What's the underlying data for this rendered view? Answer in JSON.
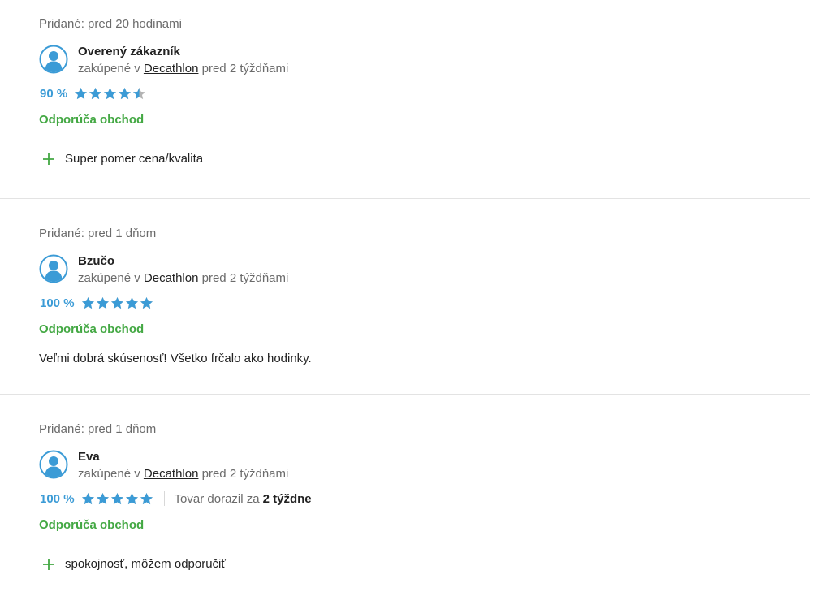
{
  "colors": {
    "accent_blue": "#3b9bd6",
    "recommend_green": "#43a843",
    "star_empty": "#b3b3b3"
  },
  "icons": {
    "avatar": "user-avatar-icon",
    "star": "star-icon",
    "pro": "plus-icon"
  },
  "reviews": [
    {
      "added": "Pridané: pred 20 hodinami",
      "author": "Overený zákazník",
      "purchase_prefix": "zakúpené v",
      "shop": "Decathlon",
      "purchase_suffix": "pred 2 týždňami",
      "percent": "90 %",
      "rating_fraction": 0.9,
      "recommends": "Odporúča obchod",
      "pro": "Super pomer cena/kvalita"
    },
    {
      "added": "Pridané: pred 1 dňom",
      "author": "Bzučo",
      "purchase_prefix": "zakúpené v",
      "shop": "Decathlon",
      "purchase_suffix": "pred 2 týždňami",
      "percent": "100 %",
      "rating_fraction": 1.0,
      "recommends": "Odporúča obchod",
      "comment": "Veľmi dobrá skúsenosť! Všetko frčalo ako hodinky."
    },
    {
      "added": "Pridané: pred 1 dňom",
      "author": "Eva",
      "purchase_prefix": "zakúpené v",
      "shop": "Decathlon",
      "purchase_suffix": "pred 2 týždňami",
      "percent": "100 %",
      "rating_fraction": 1.0,
      "delivery_label": "Tovar dorazil za",
      "delivery_value": "2 týždne",
      "recommends": "Odporúča obchod",
      "pro": "spokojnosť, môžem odporučiť"
    }
  ]
}
